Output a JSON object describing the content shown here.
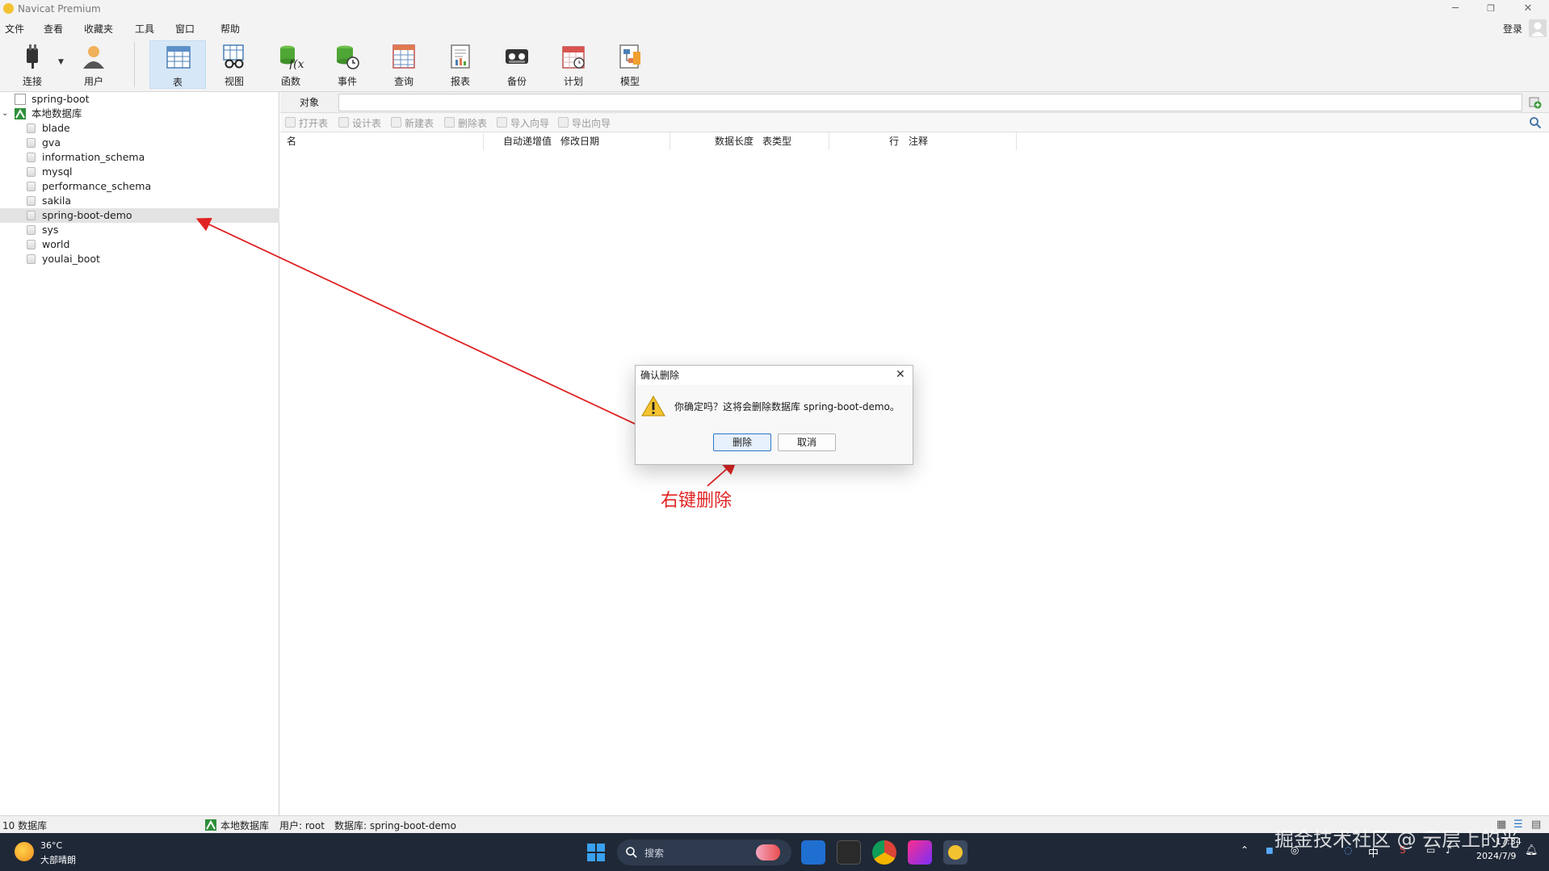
{
  "window": {
    "title": "Navicat Premium",
    "login_label": "登录"
  },
  "menu": [
    "文件",
    "查看",
    "收藏夹",
    "工具",
    "窗口",
    "帮助"
  ],
  "toolbar": [
    {
      "label": "连接",
      "icon": "plug-icon"
    },
    {
      "label": "用户",
      "icon": "user-icon"
    },
    {
      "label": "表",
      "icon": "table-icon",
      "active": true
    },
    {
      "label": "视图",
      "icon": "view-glasses-icon"
    },
    {
      "label": "函数",
      "icon": "function-icon"
    },
    {
      "label": "事件",
      "icon": "event-clock-icon"
    },
    {
      "label": "查询",
      "icon": "query-icon"
    },
    {
      "label": "报表",
      "icon": "report-icon"
    },
    {
      "label": "备份",
      "icon": "backup-icon"
    },
    {
      "label": "计划",
      "icon": "calendar-icon"
    },
    {
      "label": "模型",
      "icon": "model-icon"
    }
  ],
  "tree": {
    "connections": [
      "spring-boot",
      "本地数据库"
    ],
    "databases": [
      "blade",
      "gva",
      "information_schema",
      "mysql",
      "performance_schema",
      "sakila",
      "spring-boot-demo",
      "sys",
      "world",
      "youlai_boot"
    ],
    "selected": "spring-boot-demo"
  },
  "objects": {
    "tab_label": "对象",
    "actions": [
      "打开表",
      "设计表",
      "新建表",
      "删除表",
      "导入向导",
      "导出向导"
    ],
    "columns": [
      "名",
      "自动递增值",
      "修改日期",
      "数据长度",
      "表类型",
      "行",
      "注释"
    ]
  },
  "dialog": {
    "title": "确认删除",
    "message": "你确定吗？这将会删除数据库 spring-boot-demo。",
    "confirm": "删除",
    "cancel": "取消"
  },
  "annotation": "右键删除",
  "status": {
    "db_count": "10 数据库",
    "connection": "本地数据库",
    "user": "用户: root",
    "database": "数据库: spring-boot-demo"
  },
  "taskbar": {
    "weather_temp": "36°C",
    "weather_desc": "大部晴朗",
    "search_placeholder": "搜索",
    "ime": "中",
    "time": "17:34",
    "date": "2024/7/9"
  },
  "watermark": "掘金技术社区 @ 云层上的光",
  "colors": {
    "accent": "#2b76c9",
    "annotation": "#e02323",
    "taskbar": "#1f2837"
  }
}
